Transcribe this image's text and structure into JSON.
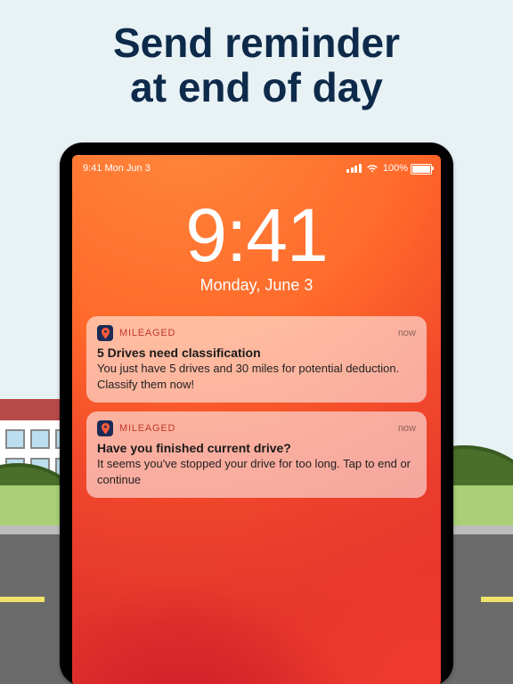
{
  "marketing": {
    "headline_line1": "Send reminder",
    "headline_line2": "at end of day"
  },
  "status_bar": {
    "left_text": "9:41 Mon Jun 3",
    "battery_pct_label": "100%",
    "wifi_icon": "wifi-icon",
    "signal_icon": "cellular-signal-icon",
    "battery_icon": "battery-full-icon"
  },
  "lock_clock": {
    "time": "9:41",
    "date": "Monday, June 3"
  },
  "notifications": [
    {
      "app_name": "MILEAGED",
      "timeago": "now",
      "title": "5 Drives need classification",
      "body": "You just have 5 drives and 30 miles for potential deduction. Classify them now!",
      "icon": "map-pin-icon"
    },
    {
      "app_name": "MILEAGED",
      "timeago": "now",
      "title": "Have you finished current drive?",
      "body": "It seems you've stopped your drive for too long. Tap to end or continue",
      "icon": "map-pin-icon"
    }
  ]
}
